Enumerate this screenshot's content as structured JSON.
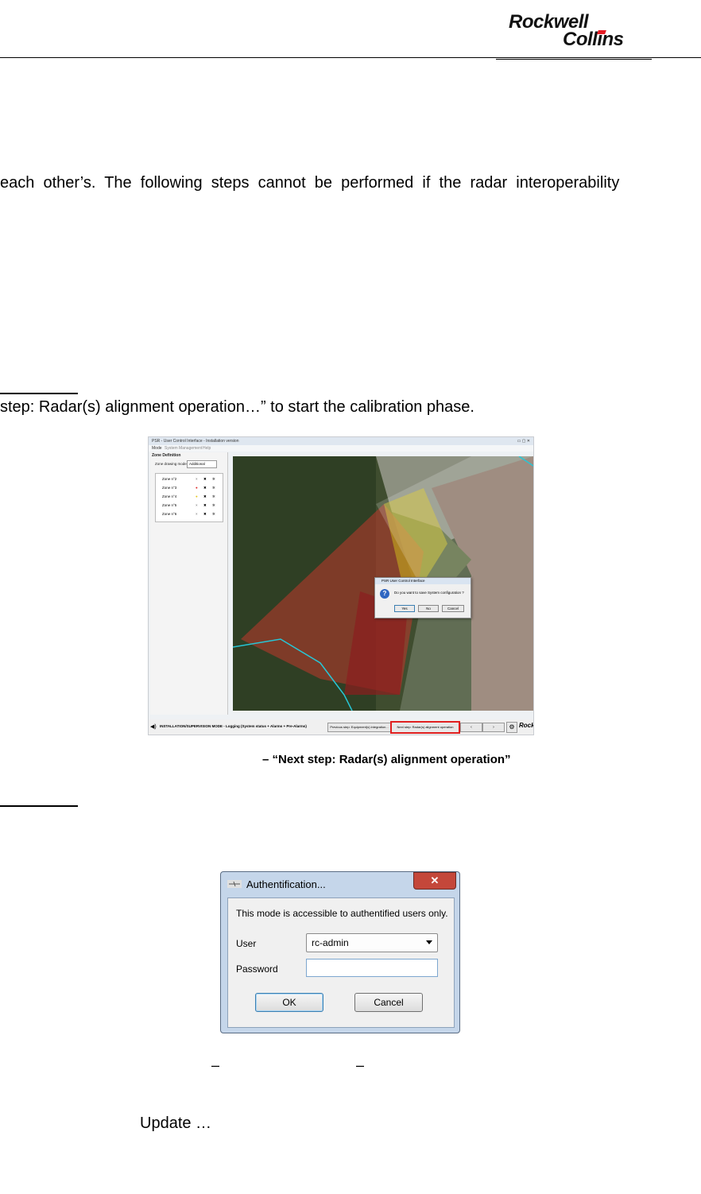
{
  "header": {
    "logo_line1": "Rockwell",
    "logo_line2": "Collins",
    "logo_colors": {
      "text": "#111111",
      "accent": "#e51b24"
    }
  },
  "paragraph1": "each  other’s.  The  following  steps  cannot  be  performed  if  the  radar  interoperability",
  "paragraph2": "step: Radar(s) alignment operation…” to start the calibration phase.",
  "figure1": {
    "window_title": "PSR - User Control Interface - Installation version",
    "menu": [
      "Mode",
      "System Management",
      "Help"
    ],
    "panel_title": "Zone Definition",
    "drawing_mode_label": "Zone drawing mode",
    "drawing_mode_value": "Additional",
    "zones": [
      {
        "name": "Zone n°2",
        "state": "none"
      },
      {
        "name": "Zone n°3",
        "state": "red"
      },
      {
        "name": "Zone n°4",
        "state": "yellow"
      },
      {
        "name": "Zone n°5",
        "state": "none"
      },
      {
        "name": "Zone n°6",
        "state": "none"
      }
    ],
    "dialog_title": "PSR User Control Interface",
    "dialog_text": "Do you want to save System configuration ?",
    "dialog_buttons": [
      "Yes",
      "No",
      "Cancel"
    ],
    "status_text": "INSTALLATION/SUPERVISION MODE - Logging (System status + Alarms + Pre-Alarms)",
    "prev_button": "Previous step: Equipment(s) integration...",
    "next_button": "Next step: Radar(s) alignment operation",
    "highlight_color": "#e02020",
    "zone_colors": {
      "red": "#c0392b",
      "yellow": "#d4c21a",
      "cyan": "#27c6d6"
    }
  },
  "caption1": "– “Next step: Radar(s) alignment operation”",
  "auth_dialog": {
    "title": "Authentification...",
    "close_glyph": "✕",
    "message": "This mode is accessible to authentified users only.",
    "user_label": "User",
    "user_value": "rc-admin",
    "password_label": "Password",
    "password_value": "",
    "ok_label": "OK",
    "cancel_label": "Cancel"
  },
  "caption2_dashes": [
    "–",
    "–"
  ],
  "update_text": "Update …"
}
